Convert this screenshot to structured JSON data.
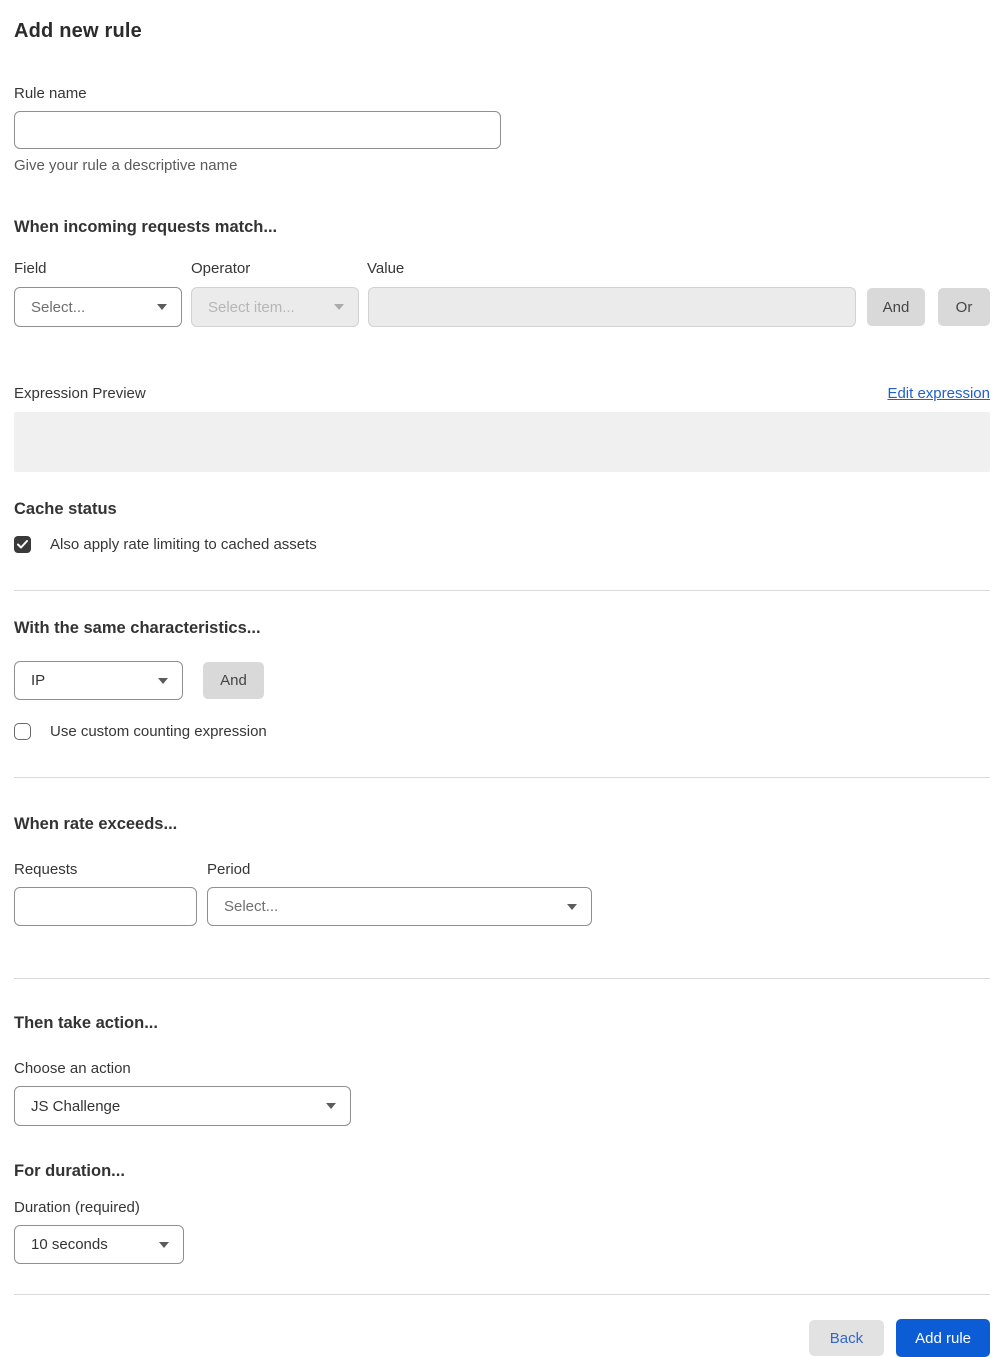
{
  "page": {
    "title": "Add new rule"
  },
  "colors": {
    "primary_blue": "#0b5cd5",
    "link_blue": "#2160cd"
  },
  "rule_name": {
    "label": "Rule name",
    "value": "",
    "helper": "Give your rule a descriptive name"
  },
  "match_section": {
    "heading": "When incoming requests match...",
    "field": {
      "label": "Field",
      "selected": "Select..."
    },
    "operator": {
      "label": "Operator",
      "selected": "Select item..."
    },
    "value": {
      "label": "Value",
      "value": ""
    },
    "and_label": "And",
    "or_label": "Or"
  },
  "expression": {
    "label": "Expression Preview",
    "edit_link": "Edit expression",
    "preview": ""
  },
  "cache_status": {
    "heading": "Cache status",
    "checkbox_label": "Also apply rate limiting to cached assets",
    "checked": true
  },
  "characteristics": {
    "heading": "With the same characteristics...",
    "selected": "IP",
    "and_label": "And",
    "checkbox_label": "Use custom counting expression",
    "checked": false
  },
  "rate_section": {
    "heading": "When rate exceeds...",
    "requests": {
      "label": "Requests",
      "value": ""
    },
    "period": {
      "label": "Period",
      "selected": "Select..."
    }
  },
  "action_section": {
    "heading": "Then take action...",
    "choose_label": "Choose an action",
    "selected": "JS Challenge"
  },
  "duration_section": {
    "heading": "For duration...",
    "label": "Duration (required)",
    "selected": "10 seconds"
  },
  "footer": {
    "back_label": "Back",
    "submit_label": "Add rule"
  }
}
